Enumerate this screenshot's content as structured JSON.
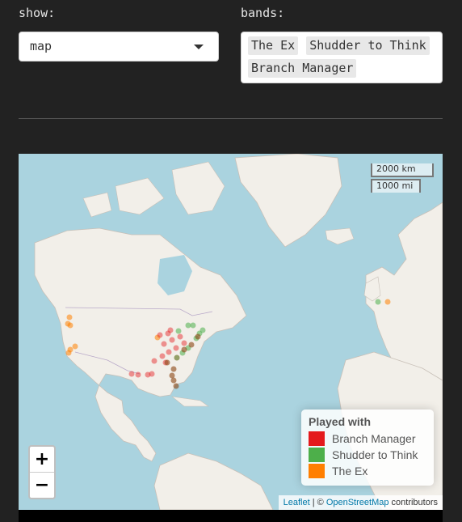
{
  "show": {
    "label": "show:",
    "value": "map"
  },
  "bands": {
    "label": "bands:",
    "selected": [
      "The Ex",
      "Shudder to Think",
      "Branch Manager"
    ]
  },
  "map": {
    "zoom_in": "+",
    "zoom_out": "−",
    "scale_km": "2000 km",
    "scale_mi": "1000 mi",
    "legend": {
      "title": "Played with",
      "items": [
        {
          "label": "Branch Manager",
          "color": "#e41a1c"
        },
        {
          "label": "Shudder to Think",
          "color": "#4daf4a"
        },
        {
          "label": "The Ex",
          "color": "#ff7f00"
        }
      ]
    },
    "attribution": {
      "leaflet": "Leaflet",
      "sep": " | © ",
      "osm": "OpenStreetMap",
      "contributors": " contributors"
    }
  }
}
